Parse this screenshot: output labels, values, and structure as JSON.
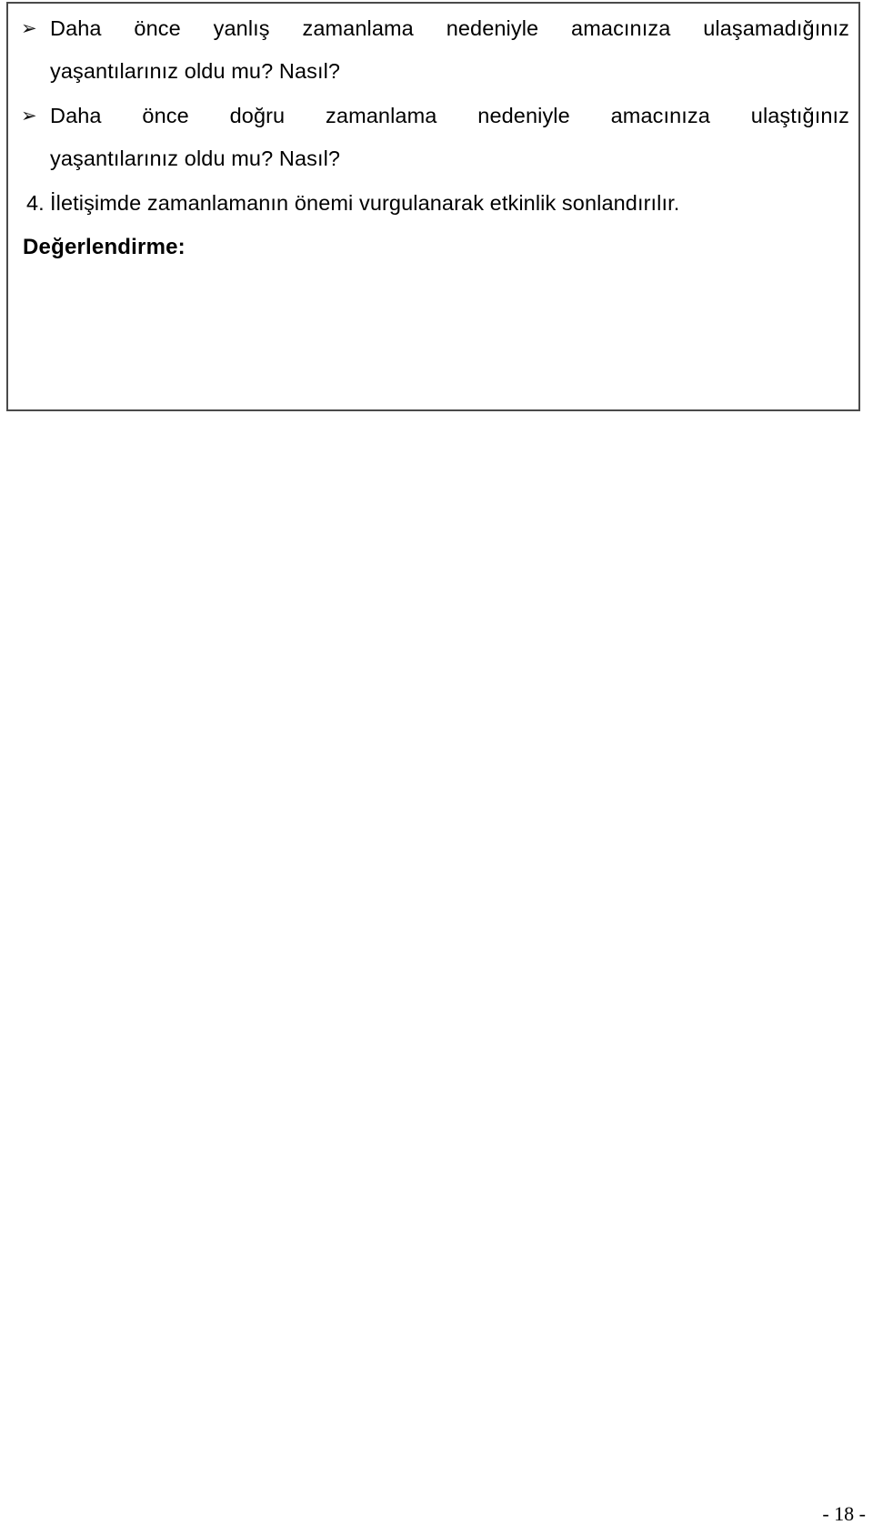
{
  "page": {
    "language": "tr",
    "background_color": "#ffffff",
    "text_color": "#000000"
  },
  "content_frame": {
    "border_color": "#4a4a4a",
    "border_width_px": 2,
    "bullet_glyph": "➢",
    "bullet_items": [
      {
        "glyph": "➢",
        "line_1": "Daha önce yanlış zamanlama nedeniyle amacınıza ulaşamadığınız",
        "line_2": "yaşantılarınız oldu mu? Nasıl?"
      },
      {
        "glyph": "➢",
        "line_1": "Daha önce doğru zamanlama nedeniyle amacınıza ulaştığınız",
        "line_2": "yaşantılarınız oldu mu? Nasıl?"
      }
    ],
    "numbered_items": [
      {
        "number": "4.",
        "text": "İletişimde zamanlamanın önemi vurgulanarak etkinlik sonlandırılır."
      }
    ],
    "heading": "Değerlendirme:"
  },
  "footer": {
    "page_number": "- 18 -"
  }
}
